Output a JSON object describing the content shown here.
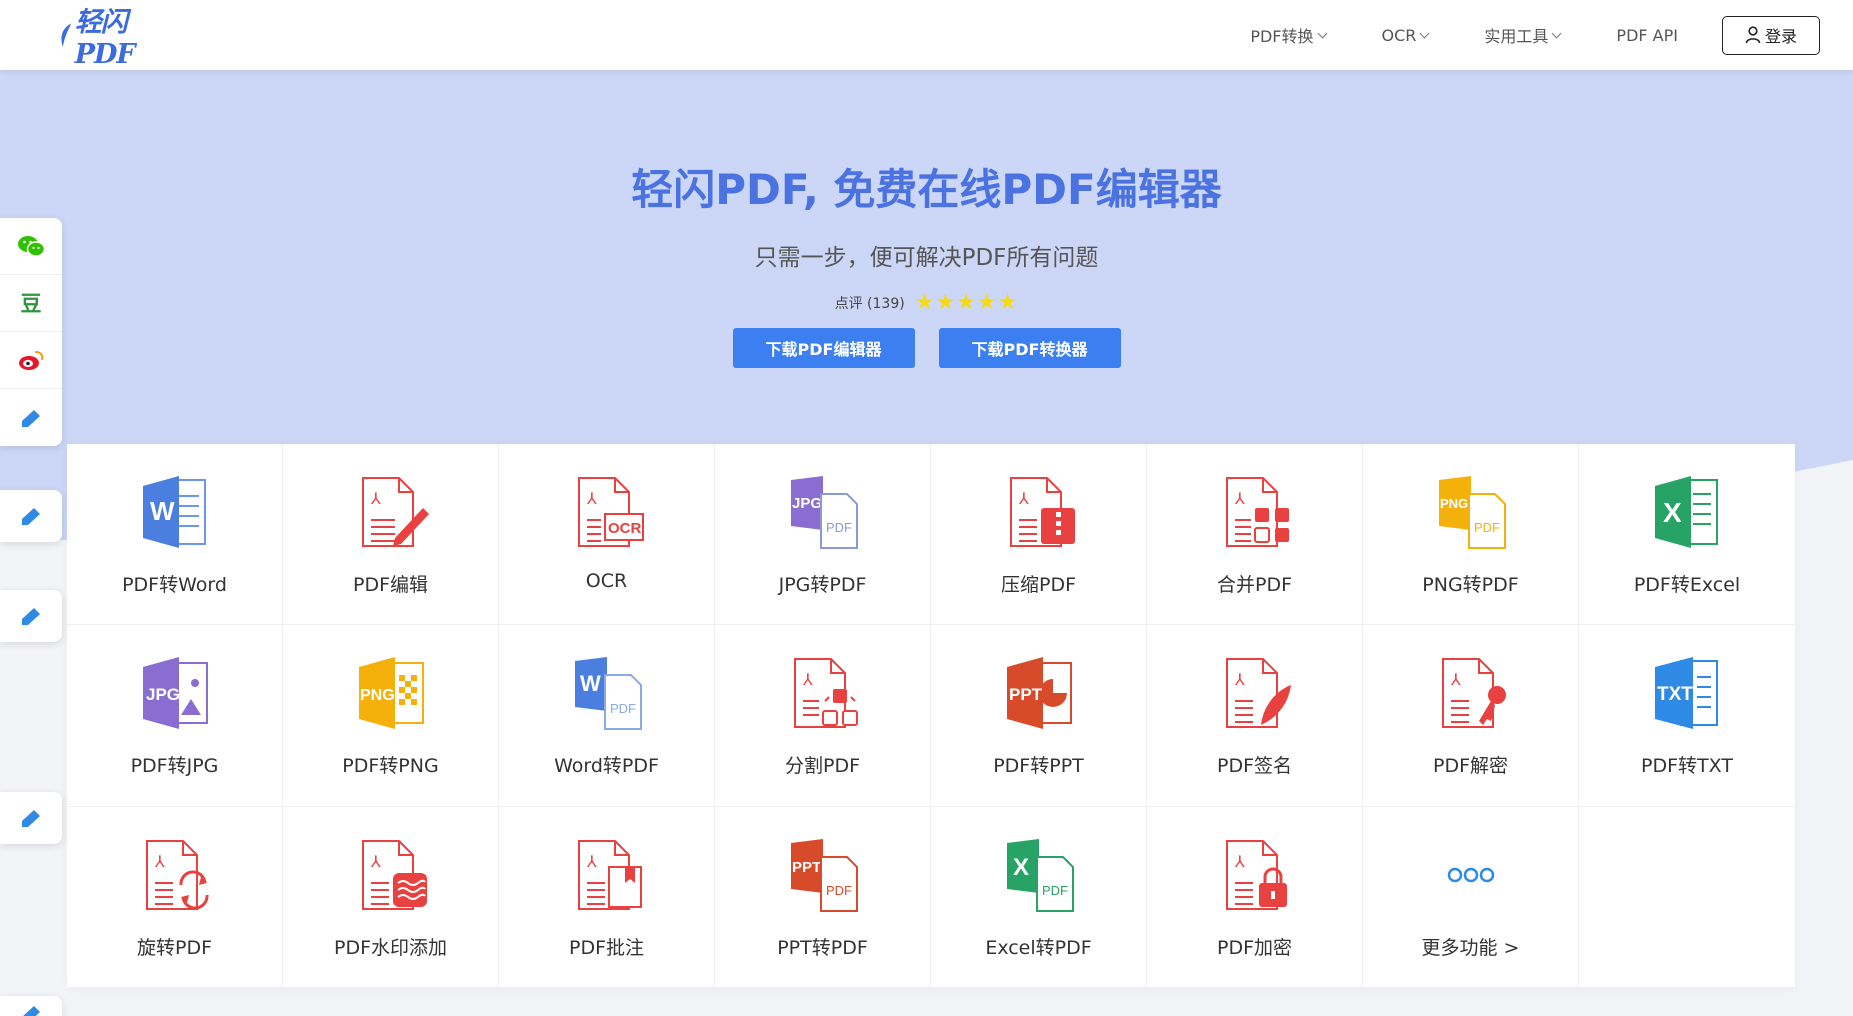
{
  "header": {
    "logo_text": "轻闪PDF",
    "nav": [
      {
        "label": "PDF转换",
        "dropdown": true
      },
      {
        "label": "OCR",
        "dropdown": true
      },
      {
        "label": "实用工具",
        "dropdown": true
      },
      {
        "label": "PDF API",
        "dropdown": false
      }
    ],
    "login_label": "登录"
  },
  "hero": {
    "title": "轻闪PDF, 免费在线PDF编辑器",
    "subtitle": "只需一步，便可解决PDF所有问题",
    "rating_text": "点评 (139)",
    "stars": 5,
    "buttons": [
      "下载PDF编辑器",
      "下载PDF转换器"
    ]
  },
  "share": {
    "items": [
      "wechat-icon",
      "douban-icon",
      "weibo-icon",
      "edit-icon"
    ],
    "douban_glyph": "豆"
  },
  "tools": [
    {
      "label": "PDF转Word",
      "icon": "word"
    },
    {
      "label": "PDF编辑",
      "icon": "pdf-edit"
    },
    {
      "label": "OCR",
      "icon": "ocr"
    },
    {
      "label": "JPG转PDF",
      "icon": "jpg-to-pdf"
    },
    {
      "label": "压缩PDF",
      "icon": "compress"
    },
    {
      "label": "合并PDF",
      "icon": "merge"
    },
    {
      "label": "PNG转PDF",
      "icon": "png-to-pdf"
    },
    {
      "label": "PDF转Excel",
      "icon": "excel"
    },
    {
      "label": "PDF转JPG",
      "icon": "jpg"
    },
    {
      "label": "PDF转PNG",
      "icon": "png"
    },
    {
      "label": "Word转PDF",
      "icon": "word-to-pdf"
    },
    {
      "label": "分割PDF",
      "icon": "split"
    },
    {
      "label": "PDF转PPT",
      "icon": "ppt"
    },
    {
      "label": "PDF签名",
      "icon": "sign"
    },
    {
      "label": "PDF解密",
      "icon": "decrypt"
    },
    {
      "label": "PDF转TXT",
      "icon": "txt"
    },
    {
      "label": "旋转PDF",
      "icon": "rotate"
    },
    {
      "label": "PDF水印添加",
      "icon": "watermark"
    },
    {
      "label": "PDF批注",
      "icon": "annotate"
    },
    {
      "label": "PPT转PDF",
      "icon": "ppt-to-pdf"
    },
    {
      "label": "Excel转PDF",
      "icon": "excel-to-pdf"
    },
    {
      "label": "PDF加密",
      "icon": "encrypt"
    },
    {
      "label": "更多功能 >",
      "icon": "more"
    }
  ],
  "colors": {
    "primary": "#3b7ff0",
    "hero_bg": "#ccd7f7",
    "title": "#4a72e0",
    "pdf_red": "#e94040",
    "word_blue": "#4a7fe0",
    "excel_green": "#27a365",
    "ppt_red": "#d84b2a",
    "jpg_purple": "#8a6dd0",
    "png_yellow": "#f4b10c",
    "star_yellow": "#f7d916"
  }
}
